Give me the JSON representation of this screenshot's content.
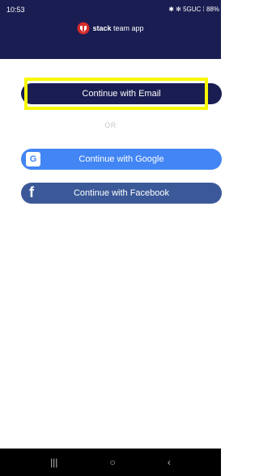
{
  "status_bar": {
    "time": "10:53",
    "right_text": "✱ ✻ 5GUC ⁞ 88%"
  },
  "brand": {
    "bold": "stack",
    "rest": " team app"
  },
  "buttons": {
    "email": "Continue with Email",
    "separator": "OR",
    "google": "Continue with Google",
    "facebook": "Continue with Facebook"
  },
  "icons": {
    "google_letter": "G",
    "facebook_letter": "f"
  },
  "nav": {
    "recent": "|||",
    "home": "○",
    "back": "‹"
  },
  "colors": {
    "header": "#1a1d52",
    "google": "#4285f4",
    "facebook": "#3b5998",
    "highlight": "#f7f700"
  }
}
